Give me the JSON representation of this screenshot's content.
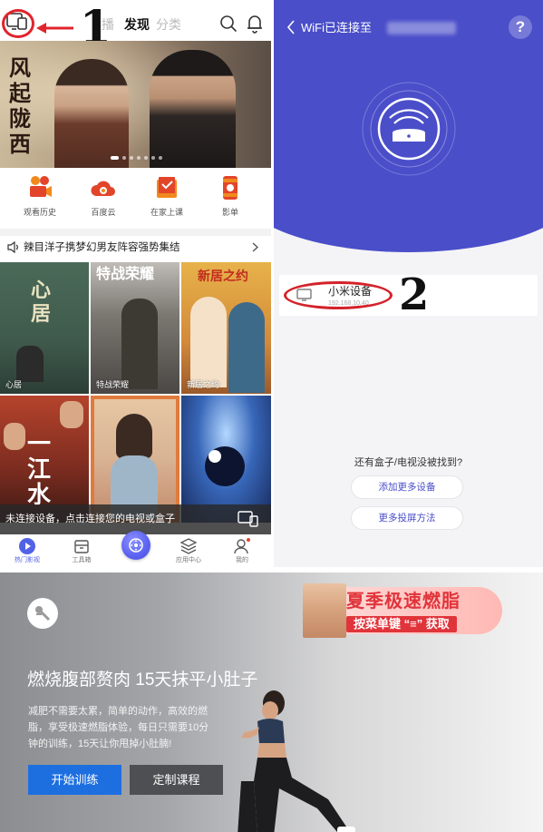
{
  "annotations": {
    "step1": "1",
    "step2": "2"
  },
  "left_app": {
    "tabs": {
      "hidden_tab": "播",
      "active_tab": "发现",
      "category_tab": "分类"
    },
    "shortcuts": [
      {
        "label": "观看历史",
        "icon": "film-camera-icon"
      },
      {
        "label": "百度云",
        "icon": "cloud-icon"
      },
      {
        "label": "在家上课",
        "icon": "book-icon"
      },
      {
        "label": "影单",
        "icon": "film-reel-icon"
      }
    ],
    "notice": "辣目洋子携梦幻男友阵容强势集结",
    "posters": [
      {
        "caption": "心居",
        "title": "心居"
      },
      {
        "caption": "特战荣耀",
        "title": "特战荣耀"
      },
      {
        "caption": "新居之约",
        "title": "新居之约"
      },
      {
        "caption": "",
        "title": "一江水"
      },
      {
        "caption": "",
        "title": ""
      },
      {
        "caption": "",
        "title": ""
      }
    ],
    "banner": {
      "calligraphy": "风起陇西"
    },
    "unconnected_bar": "未连接设备，点击连接您的电视或盒子",
    "bottom_nav": [
      {
        "label": "热门影视",
        "active": true
      },
      {
        "label": "工具箱",
        "active": false
      },
      {
        "label": "应用中心",
        "active": false
      },
      {
        "label": "我的",
        "active": false
      }
    ]
  },
  "right_app": {
    "title_prefix": "WiFi已连接至",
    "help": "?",
    "device": {
      "name": "小米设备",
      "ip": "192.168.10.40"
    },
    "not_found_text": "还有盒子/电视没被找到?",
    "add_device": "添加更多设备",
    "more_methods": "更多投屏方法"
  },
  "bottom_app": {
    "promo_line1": "夏季极速燃脂",
    "promo_line2": "按菜单键 “≡” 获取",
    "headline": "燃烧腹部赘肉 15天抹平小肚子",
    "description": "减肥不需要太累，简单的动作，高效的燃脂，享受极速燃脂体验，每日只需要10分钟的训练，15天让你甩掉小肚腩!",
    "start_button": "开始训练",
    "custom_button": "定制课程"
  },
  "colors": {
    "accent_blue": "#4a4ec9",
    "annotation_red": "#e0242c",
    "primary_button": "#1d6fe0",
    "nav_active": "#5262e6"
  }
}
